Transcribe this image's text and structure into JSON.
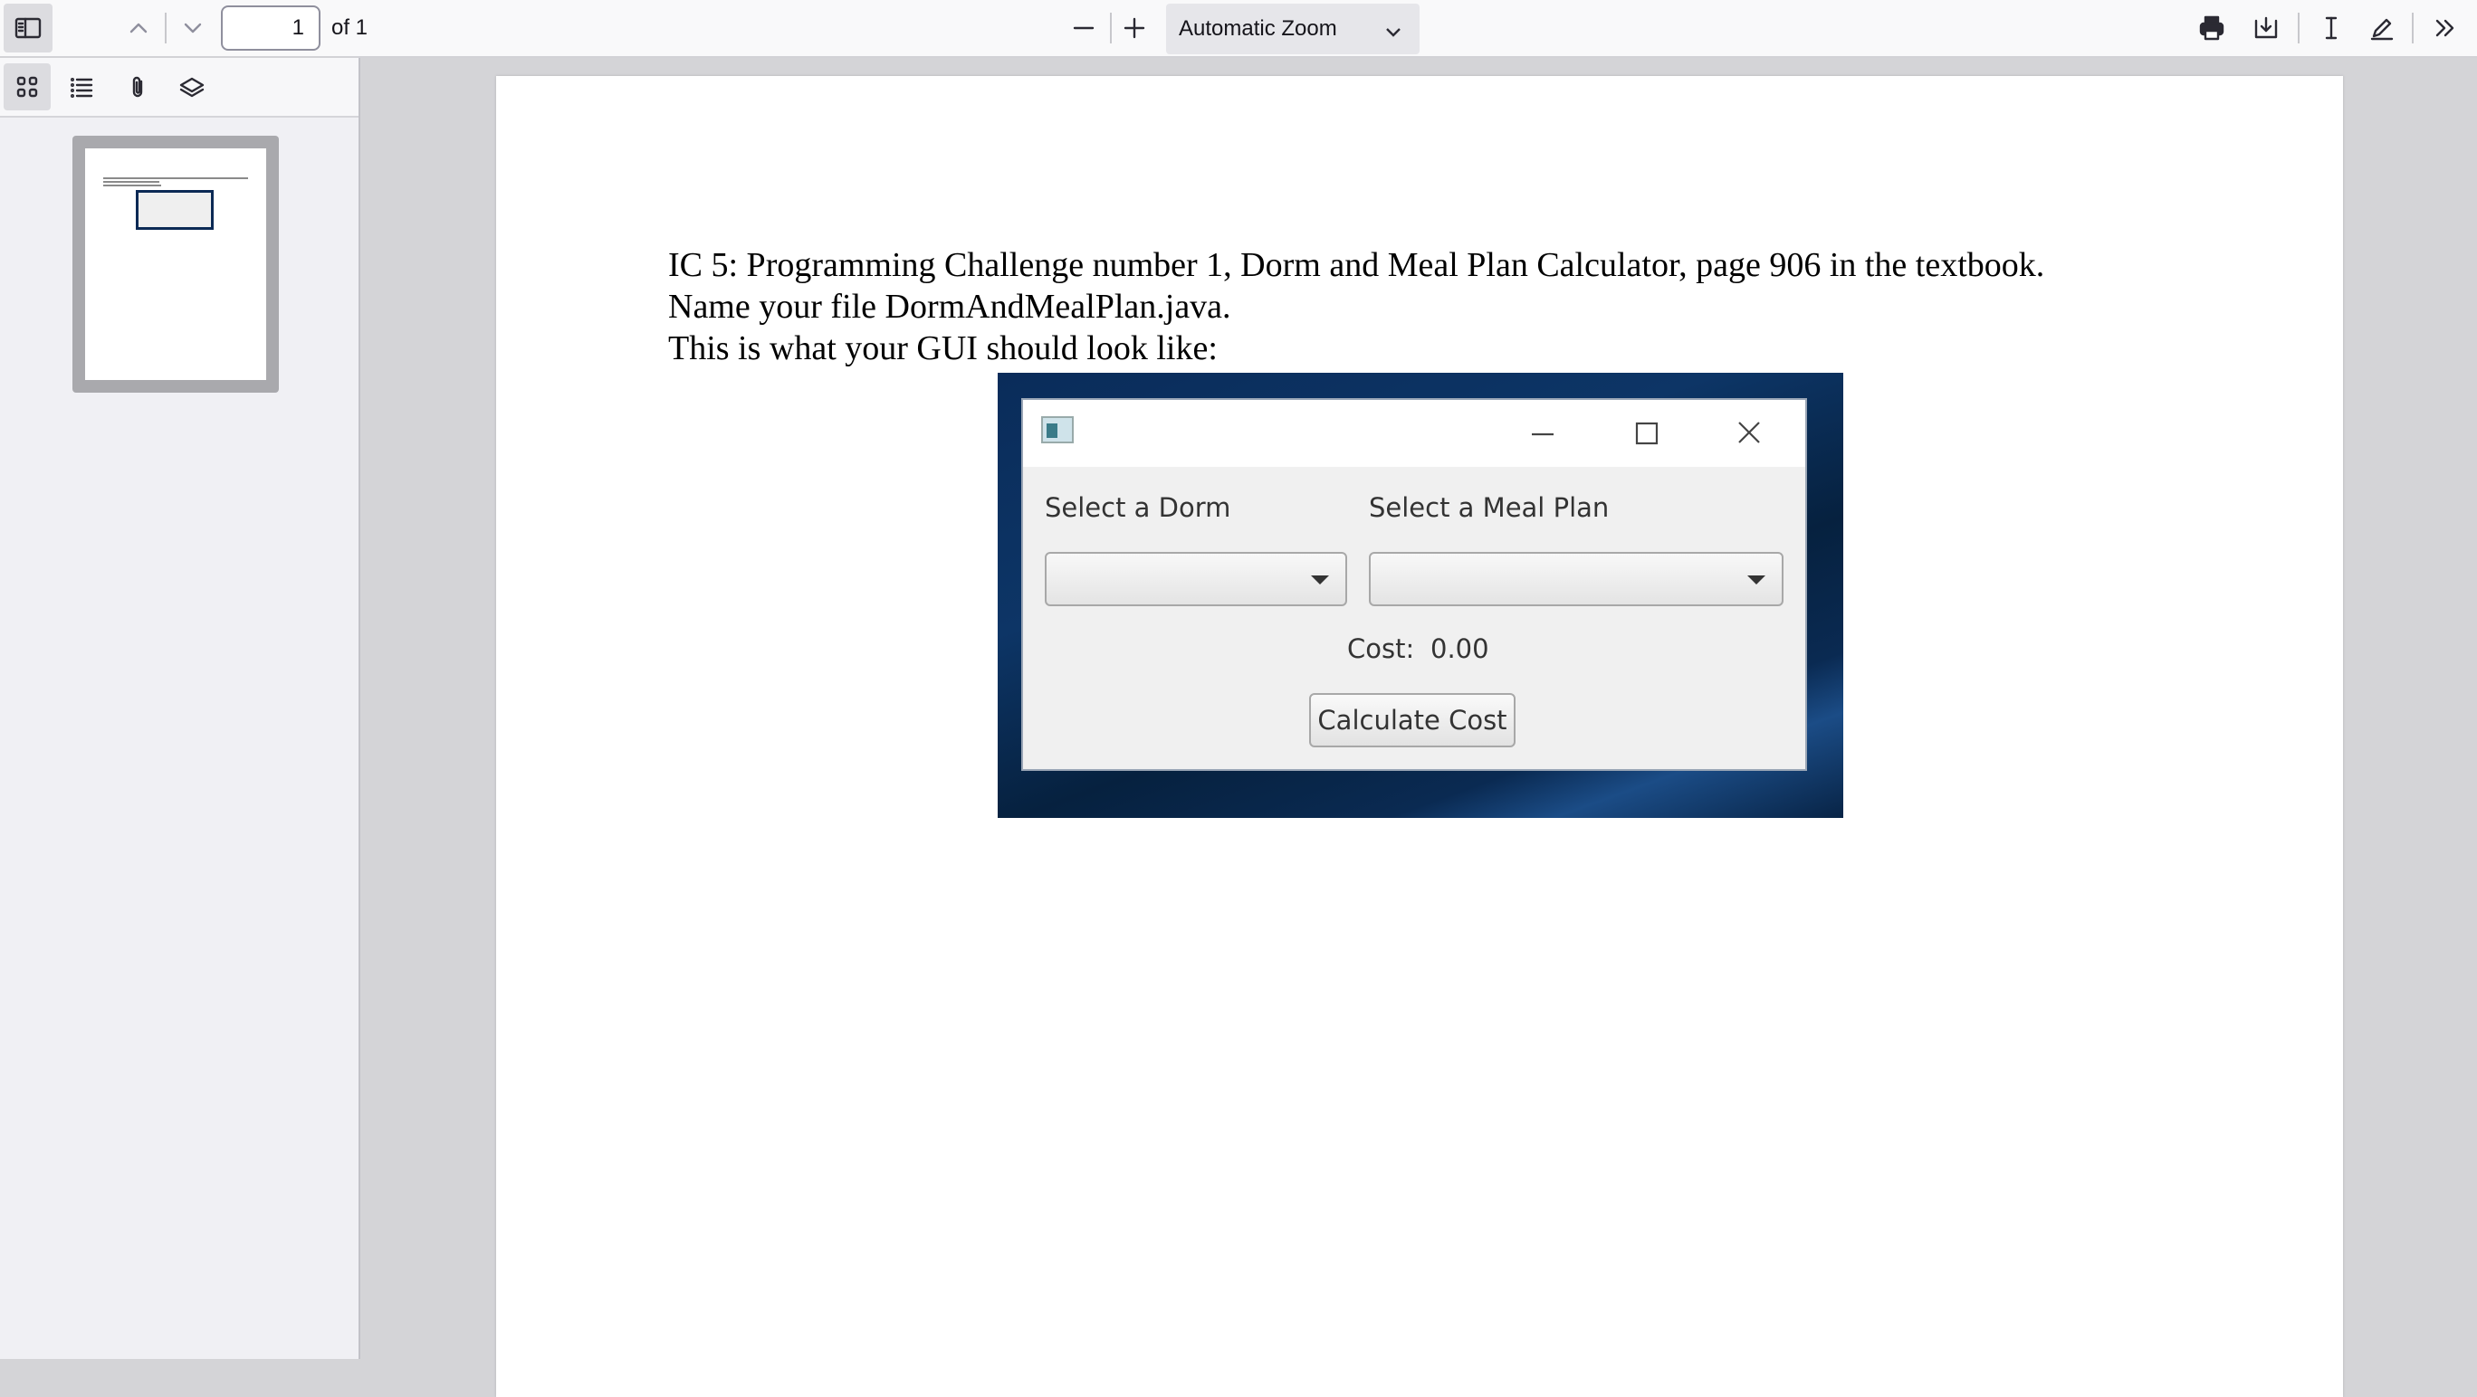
{
  "toolbar": {
    "page_number": "1",
    "page_count": "of 1",
    "zoom_label": "Automatic Zoom"
  },
  "document": {
    "lines": [
      "IC 5: Programming Challenge number 1, Dorm and Meal Plan Calculator, page 906 in the textbook.",
      "Name your file DormAndMealPlan.java.",
      "This is what your GUI should look like:"
    ],
    "gui": {
      "dorm_label": "Select a Dorm",
      "meal_label": "Select a Meal Plan",
      "cost_label": "Cost:",
      "cost_value": "0.00",
      "button_label": "Calculate Cost"
    }
  }
}
